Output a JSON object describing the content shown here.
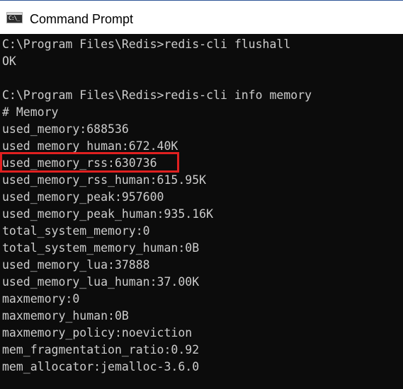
{
  "window": {
    "title": "Command Prompt",
    "icon": "command-prompt-icon",
    "icon_glyph": "C:\\_"
  },
  "console": {
    "background": "#0c0c0c",
    "text_color": "#cccccc",
    "highlight_color": "#e02020",
    "highlighted_line": "used_memory_rss:630736",
    "lines": [
      "C:\\Program Files\\Redis>redis-cli flushall",
      "OK",
      "",
      "C:\\Program Files\\Redis>redis-cli info memory",
      "# Memory",
      "used_memory:688536",
      "used_memory_human:672.40K",
      "used_memory_rss:630736",
      "used_memory_rss_human:615.95K",
      "used_memory_peak:957600",
      "used_memory_peak_human:935.16K",
      "total_system_memory:0",
      "total_system_memory_human:0B",
      "used_memory_lua:37888",
      "used_memory_lua_human:37.00K",
      "maxmemory:0",
      "maxmemory_human:0B",
      "maxmemory_policy:noeviction",
      "mem_fragmentation_ratio:0.92",
      "mem_allocator:jemalloc-3.6.0"
    ]
  }
}
